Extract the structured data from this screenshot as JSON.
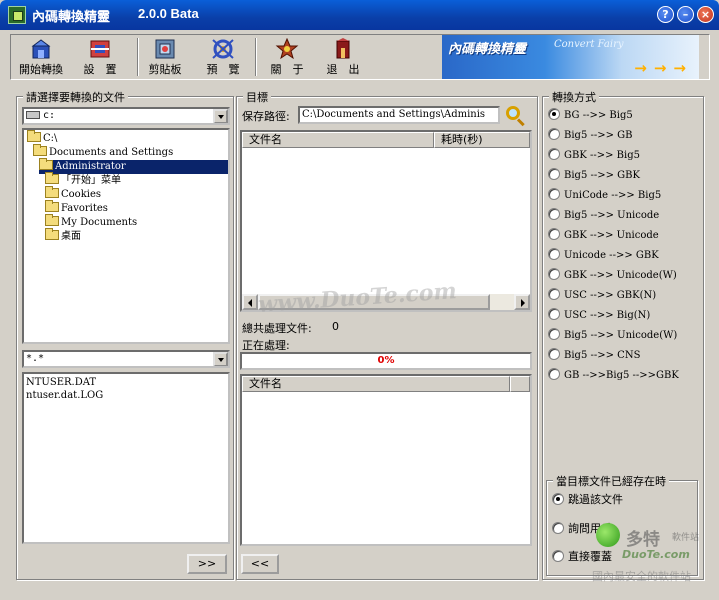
{
  "window": {
    "title": "內碼轉換精靈",
    "version": "2.0.0 Bata",
    "buttons": {
      "help": "?",
      "minimize": "–",
      "close": "×"
    }
  },
  "toolbar": {
    "items": [
      {
        "label": "開始轉換",
        "icon": "start-convert-icon"
      },
      {
        "label": "設　置",
        "icon": "settings-icon"
      },
      {
        "label": "剪貼板",
        "icon": "clipboard-icon"
      },
      {
        "label": "預　覽",
        "icon": "preview-icon"
      },
      {
        "label": "關　于",
        "icon": "about-icon"
      },
      {
        "label": "退　出",
        "icon": "exit-icon"
      }
    ],
    "banner": {
      "title": "內碼轉換精靈",
      "subtitle": "Convert Fairy",
      "arrows": "→→→"
    }
  },
  "left_panel": {
    "title": "請選擇要轉換的文件",
    "drive": "c:",
    "tree": [
      {
        "label": "C:\\",
        "depth": 0,
        "selected": false
      },
      {
        "label": "Documents and Settings",
        "depth": 1,
        "selected": false
      },
      {
        "label": "Administrator",
        "depth": 2,
        "selected": true
      },
      {
        "label": "「开始」菜单",
        "depth": 3,
        "selected": false
      },
      {
        "label": "Cookies",
        "depth": 3,
        "selected": false
      },
      {
        "label": "Favorites",
        "depth": 3,
        "selected": false
      },
      {
        "label": "My Documents",
        "depth": 3,
        "selected": false
      },
      {
        "label": "桌面",
        "depth": 3,
        "selected": false
      }
    ],
    "filter": "*.*",
    "files": [
      "NTUSER.DAT",
      "ntuser.dat.LOG"
    ],
    "add_button": ">>"
  },
  "middle_panel": {
    "title": "目標",
    "save_path_label": "保存路徑:",
    "save_path_value": "C:\\Documents and Settings\\Adminis",
    "list_headers": {
      "filename": "文件名",
      "time": "耗時(秒)"
    },
    "total_label": "總共處理文件:",
    "total_value": "0",
    "processing_label": "正在處理:",
    "progress_text": "0%",
    "progress_value": 0,
    "bottom_header": "文件名",
    "remove_button": "<<"
  },
  "right_panel": {
    "title": "轉換方式",
    "options": [
      {
        "label": "BG -->> Big5",
        "checked": true
      },
      {
        "label": "Big5 -->> GB",
        "checked": false
      },
      {
        "label": "GBK -->> Big5",
        "checked": false
      },
      {
        "label": "Big5 -->> GBK",
        "checked": false
      },
      {
        "label": "UniCode -->> Big5",
        "checked": false
      },
      {
        "label": "Big5 -->> Unicode",
        "checked": false
      },
      {
        "label": "GBK -->> Unicode",
        "checked": false
      },
      {
        "label": "Unicode -->> GBK",
        "checked": false
      },
      {
        "label": "GBK -->> Unicode(W)",
        "checked": false
      },
      {
        "label": "USC -->> GBK(N)",
        "checked": false
      },
      {
        "label": "USC -->> Big(N)",
        "checked": false
      },
      {
        "label": "Big5 -->> Unicode(W)",
        "checked": false
      },
      {
        "label": "Big5 -->> CNS",
        "checked": false
      },
      {
        "label": "GB -->>Big5 -->>GBK",
        "checked": false
      }
    ],
    "exists_title": "當目標文件已經存在時",
    "exists_options": [
      {
        "label": "跳過該文件",
        "checked": true
      },
      {
        "label": "詢問用戶",
        "checked": false
      },
      {
        "label": "直接覆蓋",
        "checked": false
      }
    ]
  },
  "watermark": {
    "center": "www.DuoTe.com",
    "badge_text": "多特",
    "badge_sub": "軟件站",
    "domain": "DuoTe.com",
    "bottom": "國內最安全的軟件站"
  }
}
